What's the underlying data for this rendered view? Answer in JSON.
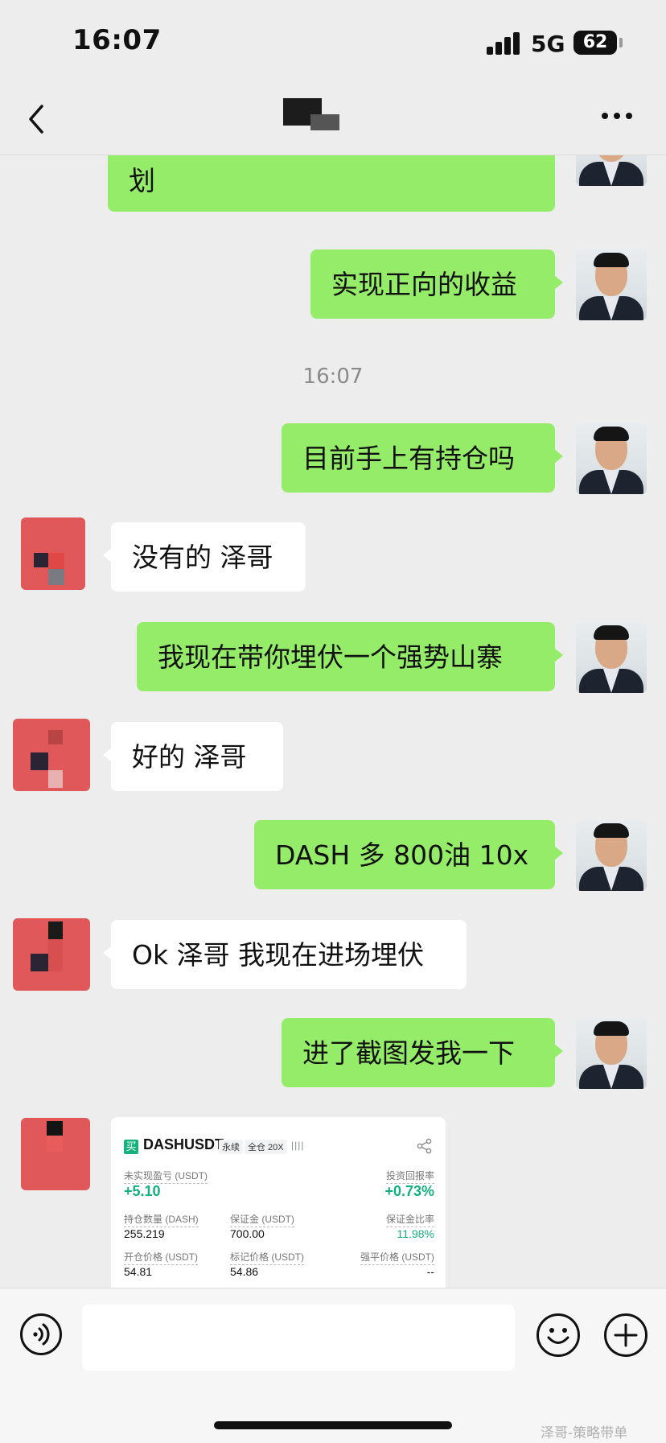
{
  "status_bar": {
    "time": "16:07",
    "network": "5G",
    "battery": "62"
  },
  "nav": {
    "title": "",
    "back_icon": "chevron-left-icon",
    "more_icon": "more-icon"
  },
  "messages": [
    {
      "side": "out",
      "text": "划"
    },
    {
      "side": "out",
      "text": "实现正向的收益"
    },
    {
      "side": "out",
      "text": "目前手上有持仓吗"
    },
    {
      "side": "in",
      "text": "没有的 泽哥"
    },
    {
      "side": "out",
      "text": "我现在带你埋伏一个强势山寨"
    },
    {
      "side": "in",
      "text": "好的 泽哥"
    },
    {
      "side": "out",
      "text": "DASH 多 800油 10x"
    },
    {
      "side": "in",
      "text": "Ok 泽哥 我现在进场埋伏"
    },
    {
      "side": "out",
      "text": "进了截图发我一下"
    }
  ],
  "timestamp": "16:07",
  "trade_card": {
    "side_tag": "买",
    "symbol": "DASHUSDT",
    "type": "永续",
    "margin_mode": "全仓 20X",
    "bars": "||||",
    "unrealized_pnl_label": "未实现盈亏 (USDT)",
    "unrealized_pnl": "+5.10",
    "roi_label": "投资回报率",
    "roi": "+0.73%",
    "position_size_label": "持仓数量 (DASH)",
    "position_size": "255.219",
    "margin_label": "保证金 (USDT)",
    "margin": "700.00",
    "margin_ratio_label": "保证金比率",
    "margin_ratio": "11.98%",
    "entry_price_label": "开仓价格 (USDT)",
    "entry_price": "54.81",
    "mark_price_label": "标记价格 (USDT)",
    "mark_price": "54.86",
    "liq_price_label": "强平价格 (USDT)",
    "liq_price": "--",
    "colors": {
      "green": "#14b17b"
    }
  },
  "input_bar": {
    "voice_icon": "voice-icon",
    "emoji_icon": "emoji-icon",
    "plus_icon": "plus-icon",
    "watermark": "泽哥-策略带单"
  },
  "colors": {
    "outgoing_bubble": "#95ec69",
    "incoming_bubble": "#ffffff",
    "background": "#ededed"
  }
}
